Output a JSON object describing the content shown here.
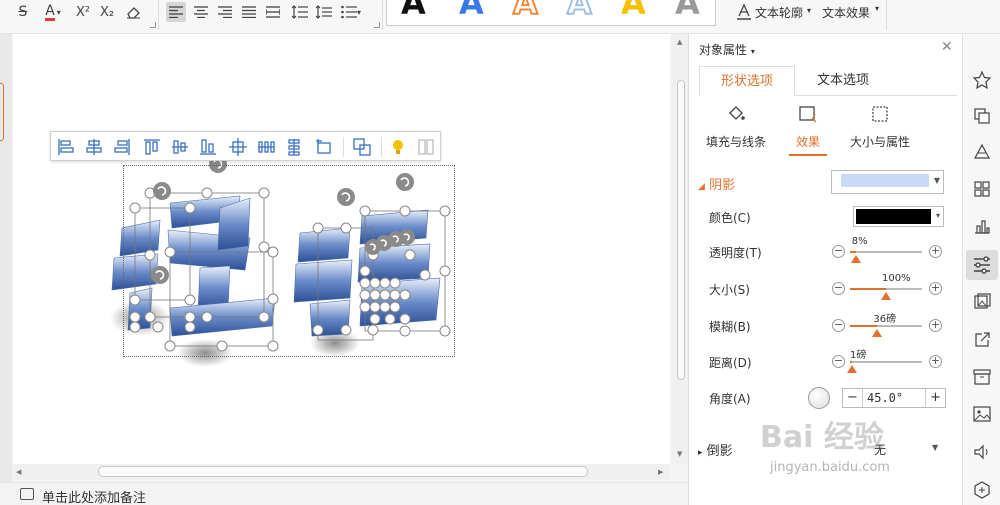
{
  "ribbon": {
    "format_icons": [
      "strikethrough-icon",
      "font-color-icon",
      "superscript-icon",
      "subscript-icon",
      "clear-format-icon"
    ],
    "strike_glyph": "S",
    "font_color_glyph": "A",
    "superscript_glyph": "X²",
    "subscript_glyph": "X₂",
    "font_color_swatch": "#e03c31",
    "wordart_letter": "A",
    "wordart_styles": [
      "black",
      "blue",
      "orange-outline",
      "light-blue-outline",
      "gold",
      "gray"
    ],
    "text_outline_label": "文本轮廓",
    "text_effect_label": "文本效果"
  },
  "notes": {
    "placeholder": "单击此处添加备注"
  },
  "pane": {
    "title": "对象属性",
    "tabs": [
      {
        "label": "形状选项",
        "active": true
      },
      {
        "label": "文本选项",
        "active": false
      }
    ],
    "subtabs": [
      {
        "label": "填充与线条",
        "icon": "fill-bucket-icon",
        "active": false
      },
      {
        "label": "效果",
        "icon": "effects-icon",
        "active": true
      },
      {
        "label": "大小与属性",
        "icon": "size-icon",
        "active": false
      }
    ],
    "shadow": {
      "header": "阴影",
      "preset_color": "#c9daf6",
      "color_label": "颜色(C)",
      "color_value": "#000000",
      "transparency_label": "透明度(T)",
      "transparency_value": "8%",
      "transparency_pct": 8,
      "size_label": "大小(S)",
      "size_value": "100%",
      "size_pct": 50,
      "blur_label": "模糊(B)",
      "blur_value": "36磅",
      "blur_pct": 38,
      "distance_label": "距离(D)",
      "distance_value": "1磅",
      "distance_pct": 3,
      "angle_label": "角度(A)",
      "angle_value": "45.0°"
    },
    "reflection": {
      "header": "倒影",
      "value": "无"
    }
  },
  "strip_icons": [
    "star-icon",
    "copy-icon",
    "shapes-icon",
    "grid-icon",
    "chart-icon",
    "properties-icon",
    "image-icon",
    "share-icon",
    "archive-icon",
    "picture-icon",
    "audio-icon",
    "more-icon"
  ],
  "strip_active": "properties-icon",
  "watermark": {
    "text": "Bai 经验",
    "sub": "jingyan.baidu.com"
  },
  "colors": {
    "accent": "#e0702a",
    "selection_dot": "#ffffff",
    "rotate_handle": "#8a8a8a"
  }
}
